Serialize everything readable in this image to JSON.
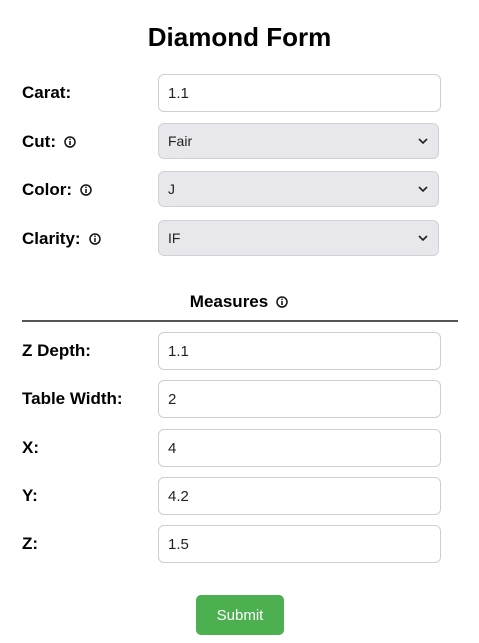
{
  "form": {
    "title": "Diamond Form",
    "submit_label": "Submit"
  },
  "fields": {
    "carat": {
      "label": "Carat:",
      "value": "1.1"
    },
    "cut": {
      "label": "Cut:",
      "value": "Fair",
      "icon": "info-icon"
    },
    "color": {
      "label": "Color:",
      "value": "J",
      "icon": "info-icon"
    },
    "clarity": {
      "label": "Clarity:",
      "value": "IF",
      "icon": "info-icon"
    }
  },
  "measures": {
    "heading": "Measures",
    "icon": "info-icon",
    "z_depth": {
      "label": "Z Depth:",
      "value": "1.1"
    },
    "table_width": {
      "label": "Table Width:",
      "value": "2"
    },
    "x": {
      "label": "X:",
      "value": "4"
    },
    "y": {
      "label": "Y:",
      "value": "4.2"
    },
    "z": {
      "label": "Z:",
      "value": "1.5"
    }
  },
  "colors": {
    "submit_button": "#4caf50",
    "select_background": "#e8e8ec",
    "divider": "#555555"
  }
}
